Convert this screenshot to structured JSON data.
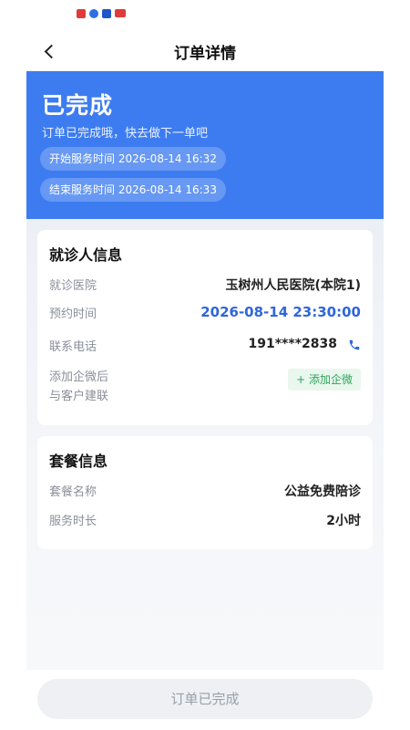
{
  "status_bar": {
    "icons": [
      "app-red-icon",
      "app-blue-icon",
      "app-navy-icon",
      "tv-icon"
    ]
  },
  "navbar": {
    "title": "订单详情",
    "back_icon": "chevron-left-icon"
  },
  "hero": {
    "status": "已完成",
    "subtitle": "订单已完成哦，快去做下一单吧",
    "start_time": "开始服务时间 2026-08-14 16:32",
    "end_time": "结束服务时间 2026-08-14 16:33",
    "color": "#3d7cf0"
  },
  "patient_card": {
    "title": "就诊人信息",
    "rows": [
      {
        "label": "就诊医院",
        "value": "玉树州人民医院(本院1)"
      },
      {
        "label": "预约时间",
        "value": "2026-08-14 23:30:00"
      },
      {
        "label": "联系电话",
        "value": "191****2838"
      }
    ],
    "phone_icon": "phone-icon",
    "wecom_label_line1": "添加企微后",
    "wecom_label_line2": "与客户建联",
    "wecom_button": "+ 添加企微"
  },
  "package_card": {
    "title": "套餐信息",
    "rows": [
      {
        "label": "套餐名称",
        "value": "公益免费陪诊"
      },
      {
        "label": "服务时长",
        "value": "2小时"
      }
    ]
  },
  "bottom": {
    "button_label": "订单已完成"
  }
}
